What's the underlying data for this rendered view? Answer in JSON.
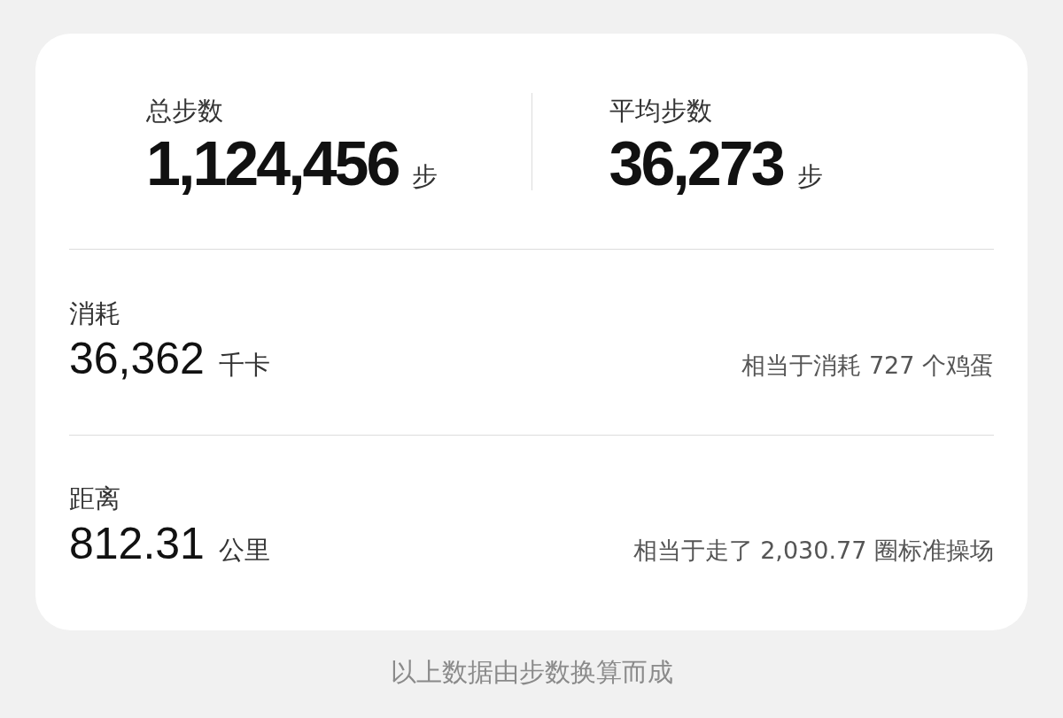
{
  "summary": [
    {
      "label": "总步数",
      "value": "1,124,456",
      "unit": "步"
    },
    {
      "label": "平均步数",
      "value": "36,273",
      "unit": "步"
    }
  ],
  "metrics": [
    {
      "label": "消耗",
      "value": "36,362",
      "unit": "千卡",
      "note": "相当于消耗 727 个鸡蛋"
    },
    {
      "label": "距离",
      "value": "812.31",
      "unit": "公里",
      "note": "相当于走了 2,030.77 圈标准操场"
    }
  ],
  "footer": "以上数据由步数换算而成"
}
